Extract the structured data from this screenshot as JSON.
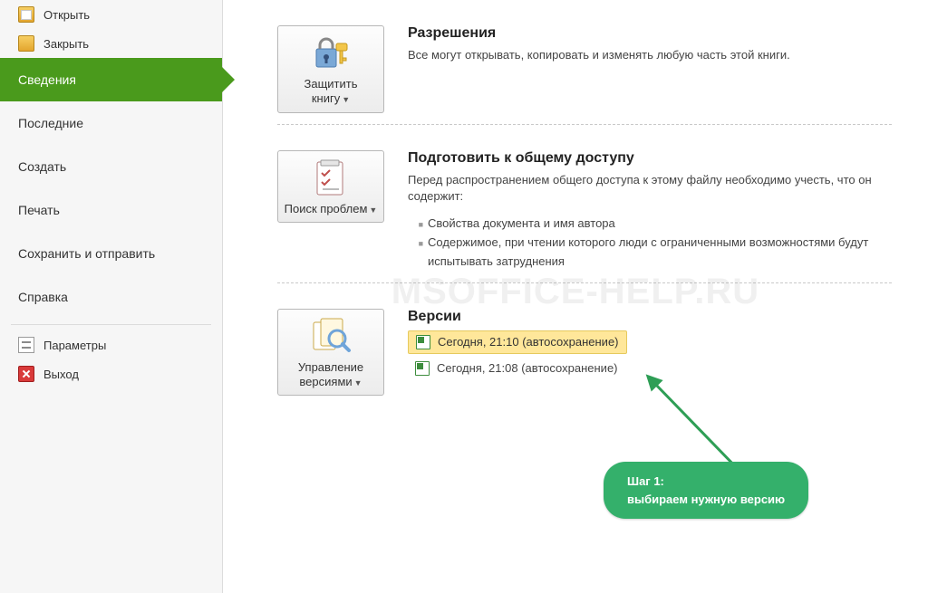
{
  "sidebar": {
    "items": [
      {
        "label": "Открыть",
        "icon": "folder-open-icon",
        "small": true
      },
      {
        "label": "Закрыть",
        "icon": "folder-close-icon",
        "small": true
      },
      {
        "label": "Сведения",
        "selected": true
      },
      {
        "label": "Последние"
      },
      {
        "label": "Создать"
      },
      {
        "label": "Печать"
      },
      {
        "label": "Сохранить и отправить"
      },
      {
        "label": "Справка"
      },
      {
        "label": "Параметры",
        "icon": "options-icon",
        "small": true
      },
      {
        "label": "Выход",
        "icon": "exit-icon",
        "small": true
      }
    ]
  },
  "sections": {
    "permissions": {
      "button_label": "Защитить книгу",
      "title": "Разрешения",
      "desc": "Все могут открывать, копировать и изменять любую часть этой книги."
    },
    "prepare": {
      "button_label": "Поиск проблем",
      "title": "Подготовить к общему доступу",
      "desc": "Перед распространением общего доступа к этому файлу необходимо учесть, что он содержит:",
      "bullet1": "Свойства документа и имя автора",
      "bullet2": "Содержимое, при чтении которого люди с ограниченными возможностями будут испытывать затруднения"
    },
    "versions": {
      "button_label": "Управление версиями",
      "title": "Версии",
      "entries": [
        {
          "label": "Сегодня, 21:10 (автосохранение)",
          "selected": true
        },
        {
          "label": "Сегодня, 21:08 (автосохранение)"
        }
      ]
    }
  },
  "callout": {
    "step_label": "Шаг 1:",
    "text": "выбираем нужную версию"
  },
  "watermark": "MSOFFICE-HELP.RU"
}
